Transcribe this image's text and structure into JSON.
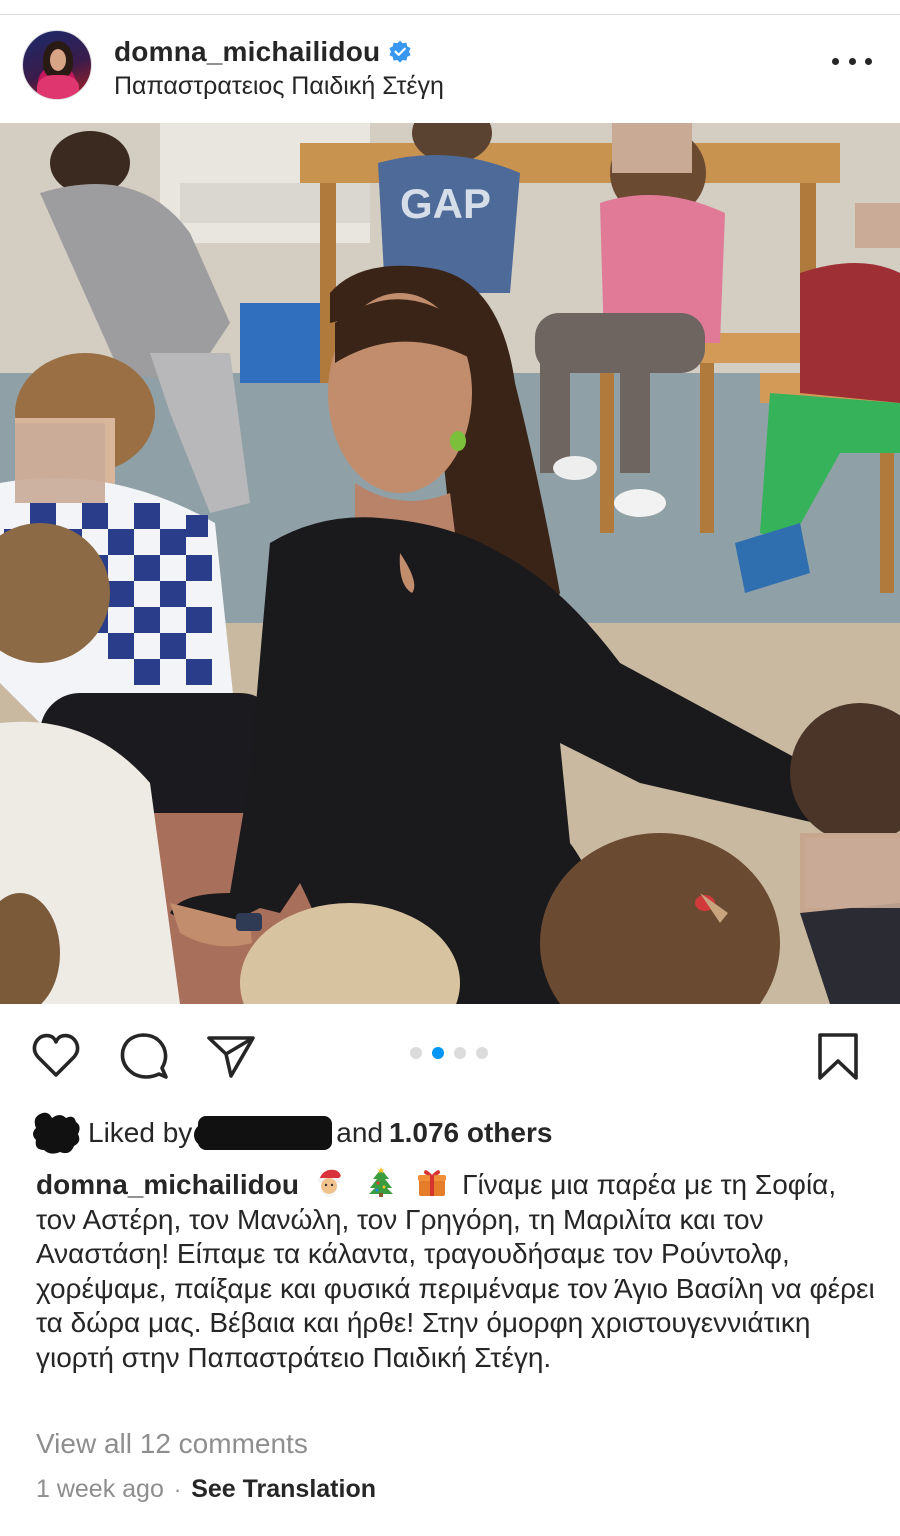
{
  "post": {
    "username": "domna_michailidou",
    "location": "Παπαστρατειος Παιδική Στέγη",
    "verified": true,
    "carousel": {
      "count": 4,
      "active_index": 1
    }
  },
  "likes": {
    "prefix": "Liked by",
    "suffix": "and",
    "count_text": "1.076 others"
  },
  "caption": {
    "username": "domna_michailidou",
    "emojis": [
      "santa-emoji",
      "christmas-tree-emoji",
      "gift-emoji"
    ],
    "text": "Γίναμε μια παρέα με τη Σοφία, τον Αστέρη, τον Μανώλη, τον Γρηγόρη, τη Μαριλίτα και τον Αναστάση! Είπαμε τα κάλαντα, τραγουδήσαμε τον Ρούντολφ, χορέψαμε, παίξαμε και φυσικά περιμέναμε τον Άγιο Βασίλη να φέρει τα δώρα μας. Βέβαια και ήρθε! Στην όμορφη χριστουγεννιάτικη γιορτή στην Παπαστράτειο Παιδική Στέγη."
  },
  "comments": {
    "view_all": "View all 12 comments"
  },
  "meta": {
    "time_ago": "1 week ago",
    "separator": "·",
    "translate_label": "See Translation"
  },
  "icons": {
    "like": "heart-icon",
    "comment": "comment-icon",
    "share": "paper-plane-icon",
    "save": "bookmark-icon",
    "more": "more-dots-icon",
    "verified": "verified-badge-icon"
  },
  "colors": {
    "text": "#262626",
    "muted": "#8e8e8e",
    "accent": "#0095f6",
    "verified": "#3897f0"
  }
}
